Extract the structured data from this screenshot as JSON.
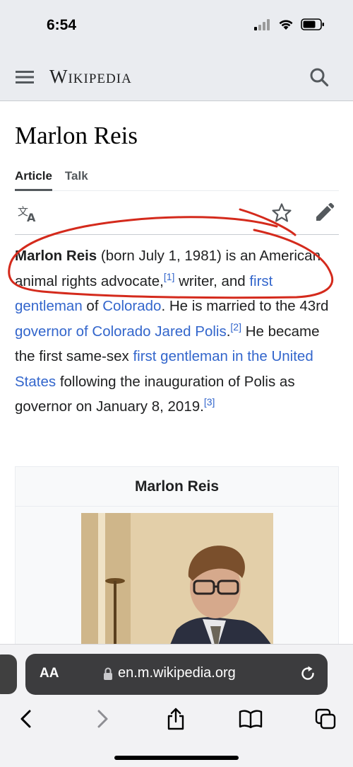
{
  "status_bar": {
    "time": "6:54"
  },
  "header": {
    "wordmark": "Wikipedia"
  },
  "article": {
    "title": "Marlon Reis",
    "tabs": [
      {
        "label": "Article"
      },
      {
        "label": "Talk"
      }
    ],
    "paragraph": {
      "subject": "Marlon Reis",
      "t1": " (born July 1, 1981) is an American animal rights advocate,",
      "ref1": "[1]",
      "t2": " writer, and ",
      "link1": "first gentleman",
      "t3": " of ",
      "link2": "Colorado",
      "t4": ". He is married to the 43rd ",
      "link3": "governor of Colorado",
      "t5": " ",
      "link4": "Jared Polis",
      "t6": ".",
      "ref2": "[2]",
      "t7": " He became the first same-sex ",
      "link5": "first gentleman in the United States",
      "t8": " following the inauguration of Polis as governor on January 8, 2019.",
      "ref3": "[3]"
    },
    "infobox": {
      "title": "Marlon Reis"
    }
  },
  "browser": {
    "text_size_label": "AA",
    "url": "en.m.wikipedia.org"
  },
  "colors": {
    "link": "#3366cc",
    "annotation": "#d42a1c",
    "chrome": "#eaecf0"
  },
  "icons": [
    "menu-icon",
    "search-icon",
    "language-icon",
    "star-icon",
    "edit-icon",
    "lock-icon",
    "reload-icon",
    "back-icon",
    "forward-icon",
    "share-icon",
    "bookmarks-icon",
    "tabs-icon"
  ]
}
